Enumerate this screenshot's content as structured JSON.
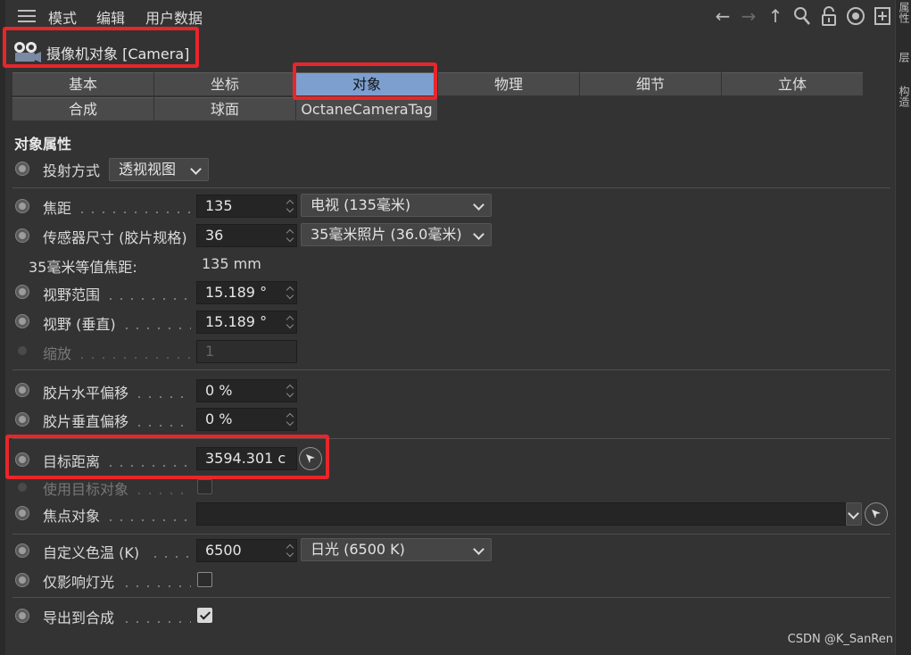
{
  "menu": {
    "items": [
      "模式",
      "编辑",
      "用户数据"
    ]
  },
  "toolbar_icons": [
    "arrow-left-icon",
    "arrow-right-icon",
    "arrow-up-icon",
    "search-icon",
    "lock-icon",
    "target-icon",
    "new-panel-icon"
  ],
  "right_strip": {
    "tabs": [
      "属性",
      "层",
      "构造"
    ]
  },
  "object": {
    "title": "摄像机对象 [Camera]",
    "icon": "camera-icon"
  },
  "tabs": {
    "row1": [
      "基本",
      "坐标",
      "对象",
      "物理",
      "细节",
      "立体"
    ],
    "row2": [
      "合成",
      "球面",
      "OctaneCameraTag"
    ],
    "active": "对象"
  },
  "section_title": "对象属性",
  "projection": {
    "label": "投射方式",
    "value": "透视视图"
  },
  "focal_length": {
    "label": "焦距",
    "value": "135",
    "preset": "电视 (135毫米)"
  },
  "sensor_size": {
    "label": "传感器尺寸 (胶片规格)",
    "value": "36",
    "preset": "35毫米照片 (36.0毫米)"
  },
  "equiv_focal": {
    "label": "35毫米等值焦距:",
    "value": "135 mm"
  },
  "fov": {
    "label": "视野范围",
    "value": "15.189 °"
  },
  "fov_vertical": {
    "label": "视野 (垂直)",
    "value": "15.189 °"
  },
  "zoom": {
    "label": "缩放",
    "value": "1"
  },
  "film_offset_x": {
    "label": "胶片水平偏移",
    "value": "0 %"
  },
  "film_offset_y": {
    "label": "胶片垂直偏移",
    "value": "0 %"
  },
  "target_distance": {
    "label": "目标距离",
    "value": "3594.301 c"
  },
  "use_target": {
    "label": "使用目标对象",
    "checked": false
  },
  "focus_object": {
    "label": "焦点对象",
    "value": ""
  },
  "color_temp": {
    "label": "自定义色温 (K)",
    "value": "6500",
    "preset": "日光 (6500 K)"
  },
  "affect_lights_only": {
    "label": "仅影响灯光",
    "checked": false
  },
  "export_to_compositing": {
    "label": "导出到合成",
    "checked": true
  },
  "highlight_color": "#e8262a",
  "active_tab_color": "#7c9fd0",
  "watermark": "CSDN @K_SanRen"
}
